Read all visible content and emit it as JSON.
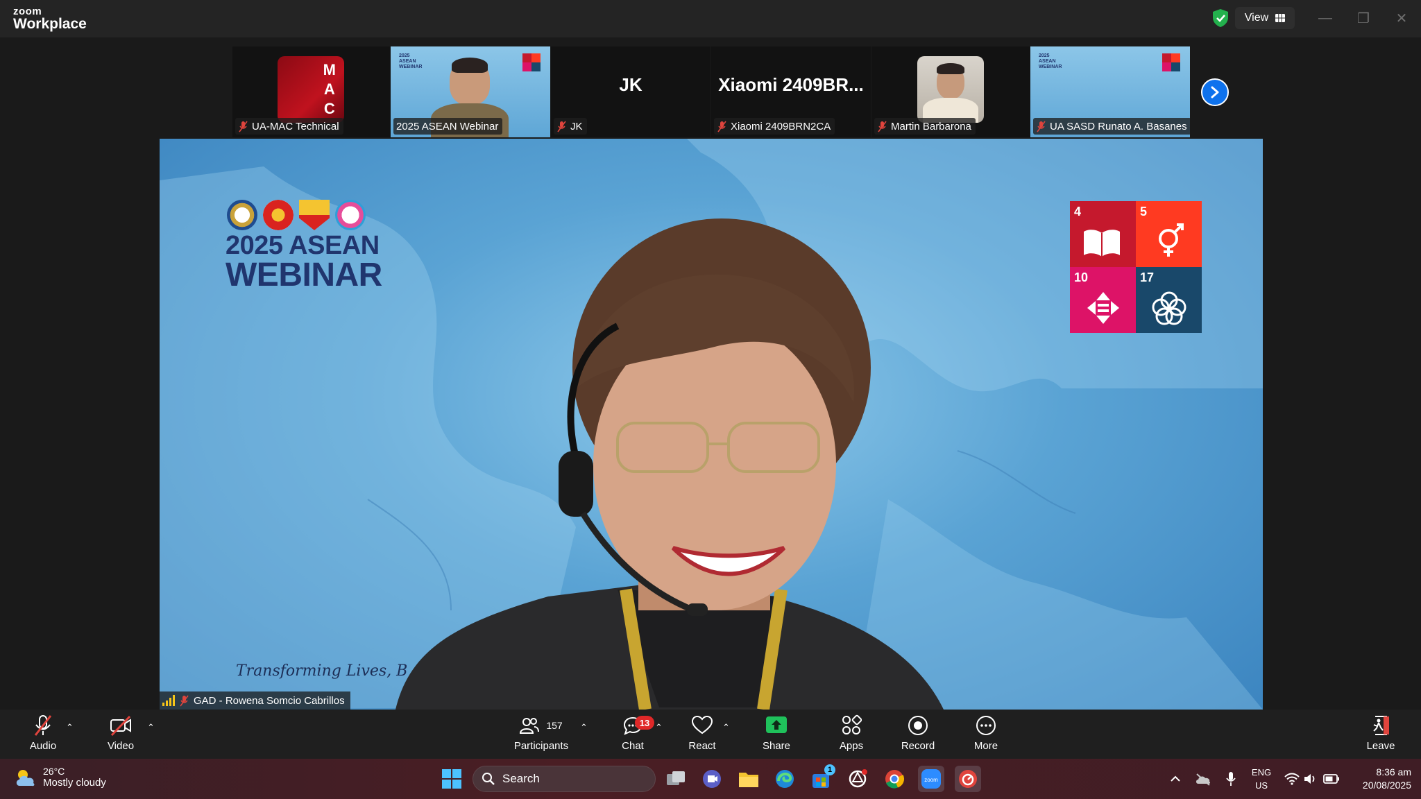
{
  "app": {
    "logo_small": "zoom",
    "logo_big": "Workplace",
    "view_label": "View"
  },
  "filmstrip": [
    {
      "name": "UA-MAC Technical",
      "avatar_text": [
        "M",
        "A",
        "C"
      ],
      "type": "logo",
      "muted": true
    },
    {
      "name": "2025 ASEAN Webinar",
      "type": "video",
      "muted": false,
      "highlight": true
    },
    {
      "name": "JK",
      "big_text": "JK",
      "type": "text",
      "muted": true
    },
    {
      "name": "Xiaomi 2409BRN2CA",
      "big_text": "Xiaomi  2409BR...",
      "type": "text",
      "muted": true
    },
    {
      "name": "Martin Barbarona",
      "type": "photo",
      "muted": true
    },
    {
      "name": "UA SASD Runato A. Basanes",
      "type": "video",
      "muted": true,
      "highlight": true
    }
  ],
  "main": {
    "speaker_name": "GAD - Rowena Somcio Cabrillos",
    "banner_line1": "2025 ASEAN",
    "banner_line2": "WEBINAR",
    "tagline": "Transforming Lives, B",
    "sdg": [
      {
        "num": "4",
        "color": "#c5192d"
      },
      {
        "num": "5",
        "color": "#ff3a21"
      },
      {
        "num": "10",
        "color": "#dd1367"
      },
      {
        "num": "17",
        "color": "#19486a"
      }
    ]
  },
  "toolbar": {
    "audio": "Audio",
    "video": "Video",
    "participants": "Participants",
    "participants_count": "157",
    "chat": "Chat",
    "chat_badge": "13",
    "react": "React",
    "share": "Share",
    "apps": "Apps",
    "record": "Record",
    "more": "More",
    "leave": "Leave"
  },
  "taskbar": {
    "temperature": "26°C",
    "weather": "Mostly cloudy",
    "search_placeholder": "Search",
    "lang_line1": "ENG",
    "lang_line2": "US",
    "time": "8:36 am",
    "date": "20/08/2025",
    "store_badge": "1"
  }
}
